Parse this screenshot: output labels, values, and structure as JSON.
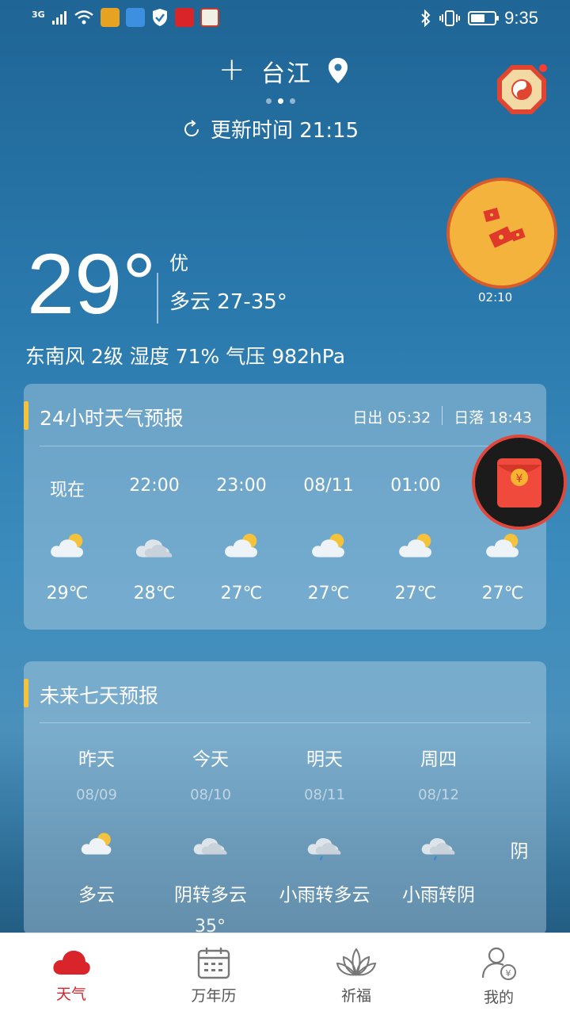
{
  "status_bar": {
    "network": "3G",
    "time": "9:35",
    "battery_level": 0.6
  },
  "header": {
    "add_label": "+",
    "city": "台江",
    "update_text": "更新时间 21:15",
    "page_dots": 3,
    "active_dot": 1
  },
  "float_ball": {
    "timer": "02:10"
  },
  "current": {
    "temperature": "29°",
    "aqi": "优",
    "condition": "多云 27-35°",
    "details": "东南风 2级 湿度 71% 气压 982hPa"
  },
  "hourly": {
    "title": "24小时天气预报",
    "sunrise": "日出 05:32",
    "sunset": "日落 18:43",
    "hours": [
      {
        "time": "现在",
        "icon": "partly-cloudy-icon",
        "temp": "29℃"
      },
      {
        "time": "22:00",
        "icon": "cloudy-icon",
        "temp": "28℃"
      },
      {
        "time": "23:00",
        "icon": "partly-cloudy-icon",
        "temp": "27℃"
      },
      {
        "time": "08/11",
        "icon": "partly-cloudy-icon",
        "temp": "27℃"
      },
      {
        "time": "01:00",
        "icon": "partly-cloudy-icon",
        "temp": "27℃"
      },
      {
        "time": "",
        "icon": "partly-cloudy-icon",
        "temp": "27℃"
      }
    ]
  },
  "daily": {
    "title": "未来七天预报",
    "days": [
      {
        "day": "昨天",
        "date": "08/09",
        "icon": "partly-cloudy-icon",
        "weather": "多云"
      },
      {
        "day": "今天",
        "date": "08/10",
        "icon": "cloudy-icon",
        "weather": "阴转多云"
      },
      {
        "day": "明天",
        "date": "08/11",
        "icon": "light-rain-icon",
        "weather": "小雨转多云"
      },
      {
        "day": "周四",
        "date": "08/12",
        "icon": "light-rain-icon",
        "weather": "小雨转阴"
      },
      {
        "day": "",
        "date": "",
        "icon": "",
        "weather": "阴"
      }
    ],
    "peek_temp": "35°"
  },
  "tabbar": {
    "tabs": [
      {
        "label": "天气",
        "icon": "cloud-icon",
        "active": true
      },
      {
        "label": "万年历",
        "icon": "calendar-icon",
        "active": false
      },
      {
        "label": "祈福",
        "icon": "lotus-icon",
        "active": false
      },
      {
        "label": "我的",
        "icon": "user-icon",
        "active": false
      }
    ]
  },
  "colors": {
    "accent_red": "#d9252a",
    "card_bar": "#f5c33b",
    "sun": "#f5c33b"
  }
}
